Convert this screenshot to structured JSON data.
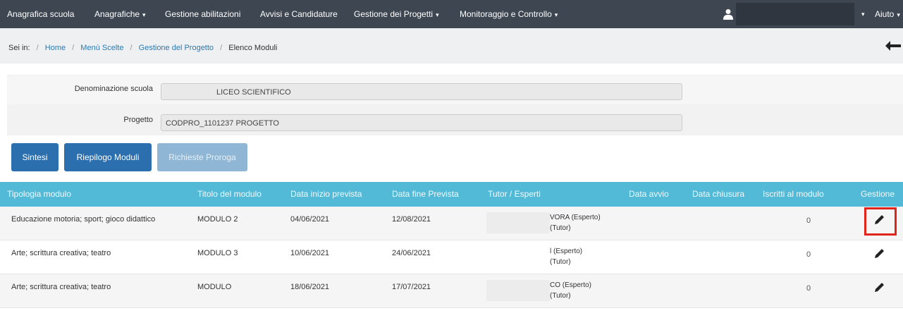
{
  "nav": {
    "items": [
      {
        "label": "Anagrafica scuola",
        "caret": false
      },
      {
        "label": "Anagrafiche",
        "caret": true
      },
      {
        "label": "Gestione abilitazioni",
        "caret": false
      },
      {
        "label": "Avvisi e Candidature",
        "caret": false
      },
      {
        "label": "Gestione dei Progetti",
        "caret": true
      },
      {
        "label": "Monitoraggio e Controllo",
        "caret": true
      }
    ],
    "help_label": "Aiuto",
    "caret": "▾"
  },
  "breadcrumb": {
    "prefix": "Sei in:",
    "links": [
      "Home",
      "Menù Scelte",
      "Gestione del Progetto"
    ],
    "current": "Elenco Moduli",
    "separator": "/"
  },
  "form": {
    "school_label": "Denominazione scuola",
    "school_value": "LICEO SCIENTIFICO",
    "project_label": "Progetto",
    "project_value": "CODPRO_1101237 PROGETTO"
  },
  "buttons": {
    "sintesi": "Sintesi",
    "riepilogo": "Riepilogo Moduli",
    "proroga": "Richieste Proroga"
  },
  "table": {
    "headers": [
      "Tipologia modulo",
      "Titolo del modulo",
      "Data inizio prevista",
      "Data fine Prevista",
      "Tutor / Esperti",
      "Data avvio",
      "Data chiusura",
      "Iscritti al modulo",
      "Gestione"
    ],
    "rows": [
      {
        "tipologia": "Educazione motoria; sport; gioco didattico",
        "titolo": "MODULO 2",
        "inizio": "04/06/2021",
        "fine": "12/08/2021",
        "tutor1": "VORA (Esperto)",
        "tutor2": "(Tutor)",
        "iscritti": "0"
      },
      {
        "tipologia": "Arte; scrittura creativa; teatro",
        "titolo": "MODULO 3",
        "inizio": "10/06/2021",
        "fine": "24/06/2021",
        "tutor1": "l (Esperto)",
        "tutor2": "(Tutor)",
        "iscritti": "0"
      },
      {
        "tipologia": "Arte; scrittura creativa; teatro",
        "titolo": "MODULO",
        "inizio": "18/06/2021",
        "fine": "17/07/2021",
        "tutor1": "CO (Esperto)",
        "tutor2": "(Tutor)",
        "iscritti": "0"
      }
    ]
  },
  "colors": {
    "navbar": "#3d4651",
    "table_header": "#52b9d6",
    "primary_button": "#2c6fae",
    "disabled_button": "#8fb6d4",
    "highlight": "#e2231a"
  },
  "icons": {
    "user": "user-icon",
    "back": "back-arrow-icon",
    "edit": "pencil-icon"
  }
}
